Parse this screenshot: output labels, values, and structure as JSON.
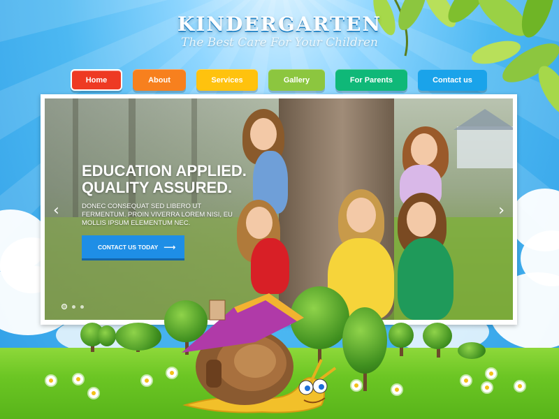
{
  "header": {
    "logo_title": "KINDERGARTEN",
    "logo_tagline": "The Best Care For Your Children"
  },
  "nav": {
    "items": [
      {
        "label": "Home",
        "color": "#ee3a23"
      },
      {
        "label": "About",
        "color": "#f7801e"
      },
      {
        "label": "Services",
        "color": "#ffc20e"
      },
      {
        "label": "Gallery",
        "color": "#8cc63f"
      },
      {
        "label": "For Parents",
        "color": "#0fb878"
      },
      {
        "label": "Contact us",
        "color": "#1aa3ea"
      }
    ],
    "active": "Home"
  },
  "slider": {
    "heading_line1": "EDUCATION APPLIED.",
    "heading_line2": "QUALITY ASSURED.",
    "text": "DONEC CONSEQUAT SED LIBERO UT FERMENTUM. PROIN VIVERRA LOREM NISI, EU MOLLIS IPSUM ELEMENTUM NEC.",
    "cta_label": "CONTACT US TODAY",
    "cta_arrow": "⟶",
    "prev_arrow": "‹",
    "next_arrow": "›",
    "slide_count": 3,
    "active_slide": 1
  },
  "colors": {
    "sky": "#4cb8f2",
    "grass": "#6cc624",
    "cta": "#1e8ee6"
  },
  "icons": [
    "prev-arrow-icon",
    "next-arrow-icon",
    "arrow-right-icon"
  ]
}
